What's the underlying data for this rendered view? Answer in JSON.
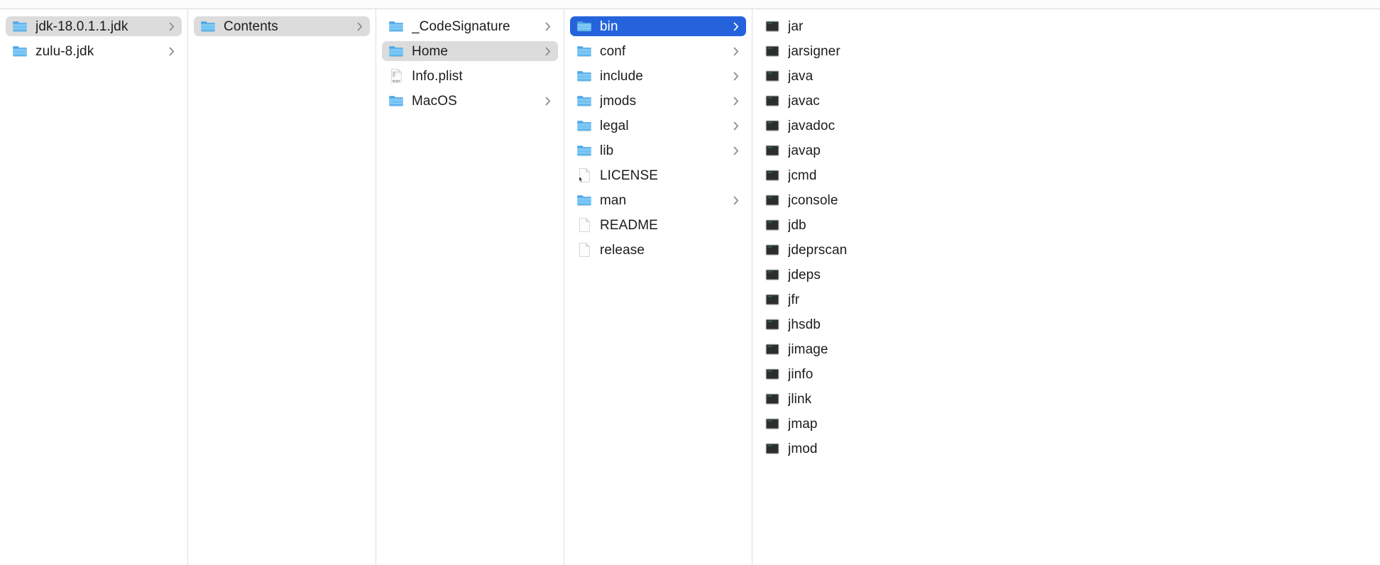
{
  "window": {
    "title": "Finder Column View",
    "view_mode": "column",
    "accent_color": "#2563dc",
    "selected_inactive_color": "#dcdcdc",
    "divider_color": "#dedede",
    "toolbar_background": "#fcfcfc"
  },
  "columns": [
    {
      "name": "column-java-virtual-machines",
      "items": [
        {
          "label": "jdk-18.0.1.1.jdk",
          "icon": "folder-icon",
          "has_disclosure": true,
          "state": "selected-inactive"
        },
        {
          "label": "zulu-8.jdk",
          "icon": "folder-icon",
          "has_disclosure": true,
          "state": "normal"
        }
      ]
    },
    {
      "name": "column-jdk-bundle",
      "items": [
        {
          "label": "Contents",
          "icon": "folder-icon",
          "has_disclosure": true,
          "state": "selected-inactive"
        }
      ]
    },
    {
      "name": "column-contents",
      "items": [
        {
          "label": "_CodeSignature",
          "icon": "folder-icon",
          "has_disclosure": true,
          "state": "normal"
        },
        {
          "label": "Home",
          "icon": "folder-icon",
          "has_disclosure": true,
          "state": "selected-inactive"
        },
        {
          "label": "Info.plist",
          "icon": "plist-file-icon",
          "has_disclosure": false,
          "state": "normal"
        },
        {
          "label": "MacOS",
          "icon": "folder-icon",
          "has_disclosure": true,
          "state": "normal"
        }
      ]
    },
    {
      "name": "column-home",
      "items": [
        {
          "label": "bin",
          "icon": "folder-icon",
          "has_disclosure": true,
          "state": "selected-active"
        },
        {
          "label": "conf",
          "icon": "folder-icon",
          "has_disclosure": true,
          "state": "normal"
        },
        {
          "label": "include",
          "icon": "folder-icon",
          "has_disclosure": true,
          "state": "normal"
        },
        {
          "label": "jmods",
          "icon": "folder-icon",
          "has_disclosure": true,
          "state": "normal"
        },
        {
          "label": "legal",
          "icon": "folder-icon",
          "has_disclosure": true,
          "state": "normal"
        },
        {
          "label": "lib",
          "icon": "folder-icon",
          "has_disclosure": true,
          "state": "normal"
        },
        {
          "label": "LICENSE",
          "icon": "alias-file-icon",
          "has_disclosure": false,
          "state": "normal"
        },
        {
          "label": "man",
          "icon": "folder-icon",
          "has_disclosure": true,
          "state": "normal"
        },
        {
          "label": "README",
          "icon": "blank-file-icon",
          "has_disclosure": false,
          "state": "normal"
        },
        {
          "label": "release",
          "icon": "blank-file-icon",
          "has_disclosure": false,
          "state": "normal"
        }
      ]
    },
    {
      "name": "column-bin",
      "items": [
        {
          "label": "jar",
          "icon": "unix-executable-icon",
          "has_disclosure": false,
          "state": "normal"
        },
        {
          "label": "jarsigner",
          "icon": "unix-executable-icon",
          "has_disclosure": false,
          "state": "normal"
        },
        {
          "label": "java",
          "icon": "unix-executable-icon",
          "has_disclosure": false,
          "state": "normal"
        },
        {
          "label": "javac",
          "icon": "unix-executable-icon",
          "has_disclosure": false,
          "state": "normal"
        },
        {
          "label": "javadoc",
          "icon": "unix-executable-icon",
          "has_disclosure": false,
          "state": "normal"
        },
        {
          "label": "javap",
          "icon": "unix-executable-icon",
          "has_disclosure": false,
          "state": "normal"
        },
        {
          "label": "jcmd",
          "icon": "unix-executable-icon",
          "has_disclosure": false,
          "state": "normal"
        },
        {
          "label": "jconsole",
          "icon": "unix-executable-icon",
          "has_disclosure": false,
          "state": "normal"
        },
        {
          "label": "jdb",
          "icon": "unix-executable-icon",
          "has_disclosure": false,
          "state": "normal"
        },
        {
          "label": "jdeprscan",
          "icon": "unix-executable-icon",
          "has_disclosure": false,
          "state": "normal"
        },
        {
          "label": "jdeps",
          "icon": "unix-executable-icon",
          "has_disclosure": false,
          "state": "normal"
        },
        {
          "label": "jfr",
          "icon": "unix-executable-icon",
          "has_disclosure": false,
          "state": "normal"
        },
        {
          "label": "jhsdb",
          "icon": "unix-executable-icon",
          "has_disclosure": false,
          "state": "normal"
        },
        {
          "label": "jimage",
          "icon": "unix-executable-icon",
          "has_disclosure": false,
          "state": "normal"
        },
        {
          "label": "jinfo",
          "icon": "unix-executable-icon",
          "has_disclosure": false,
          "state": "normal"
        },
        {
          "label": "jlink",
          "icon": "unix-executable-icon",
          "has_disclosure": false,
          "state": "normal"
        },
        {
          "label": "jmap",
          "icon": "unix-executable-icon",
          "has_disclosure": false,
          "state": "normal"
        },
        {
          "label": "jmod",
          "icon": "unix-executable-icon",
          "has_disclosure": false,
          "state": "clipped"
        }
      ]
    }
  ]
}
